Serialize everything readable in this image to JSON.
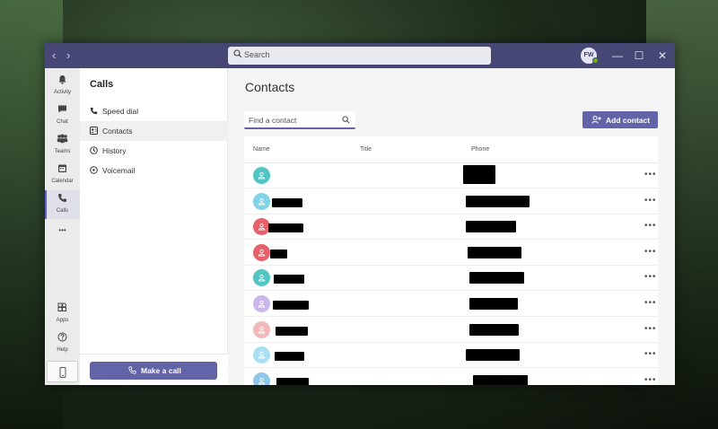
{
  "colors": {
    "titlebar": "#464775",
    "accent": "#6264a7"
  },
  "search": {
    "placeholder": "Search"
  },
  "user": {
    "initials": "FW"
  },
  "window_controls": {
    "minimize": "—",
    "maximize": "☐",
    "close": "✕"
  },
  "rail": {
    "activity": "Activity",
    "chat": "Chat",
    "teams": "Teams",
    "calendar": "Calendar",
    "calls": "Calls",
    "more": "•••",
    "apps": "Apps",
    "help": "Help"
  },
  "panel": {
    "title": "Calls",
    "items": [
      {
        "label": "Speed dial",
        "icon": "phone-icon"
      },
      {
        "label": "Contacts",
        "icon": "contact-card-icon"
      },
      {
        "label": "History",
        "icon": "clock-icon"
      },
      {
        "label": "Voicemail",
        "icon": "voicemail-icon"
      }
    ],
    "make_call": "Make a call"
  },
  "main": {
    "title": "Contacts",
    "find_placeholder": "Find a contact",
    "add_contact": "Add contact",
    "columns": {
      "name": "Name",
      "title": "Title",
      "phone": "Phone"
    },
    "more": "•••",
    "rows": [
      {
        "avatar_color": "#4fc6c3",
        "name_redacted": false,
        "phone_redacted": true
      },
      {
        "avatar_color": "#7fd3e6",
        "name_redacted": true,
        "phone_redacted": true
      },
      {
        "avatar_color": "#e8606b",
        "name_redacted": true,
        "phone_redacted": true
      },
      {
        "avatar_color": "#e8606b",
        "name_redacted": true,
        "phone_redacted": true
      },
      {
        "avatar_color": "#4fc6c3",
        "name_redacted": true,
        "phone_redacted": true
      },
      {
        "avatar_color": "#c9b6ec",
        "name_redacted": true,
        "phone_redacted": true
      },
      {
        "avatar_color": "#f3b8b8",
        "name_redacted": true,
        "phone_redacted": true
      },
      {
        "avatar_color": "#a9dff0",
        "name_redacted": true,
        "phone_redacted": true
      },
      {
        "avatar_color": "#8ec7e8",
        "name_redacted": true,
        "phone_redacted": true
      }
    ]
  }
}
